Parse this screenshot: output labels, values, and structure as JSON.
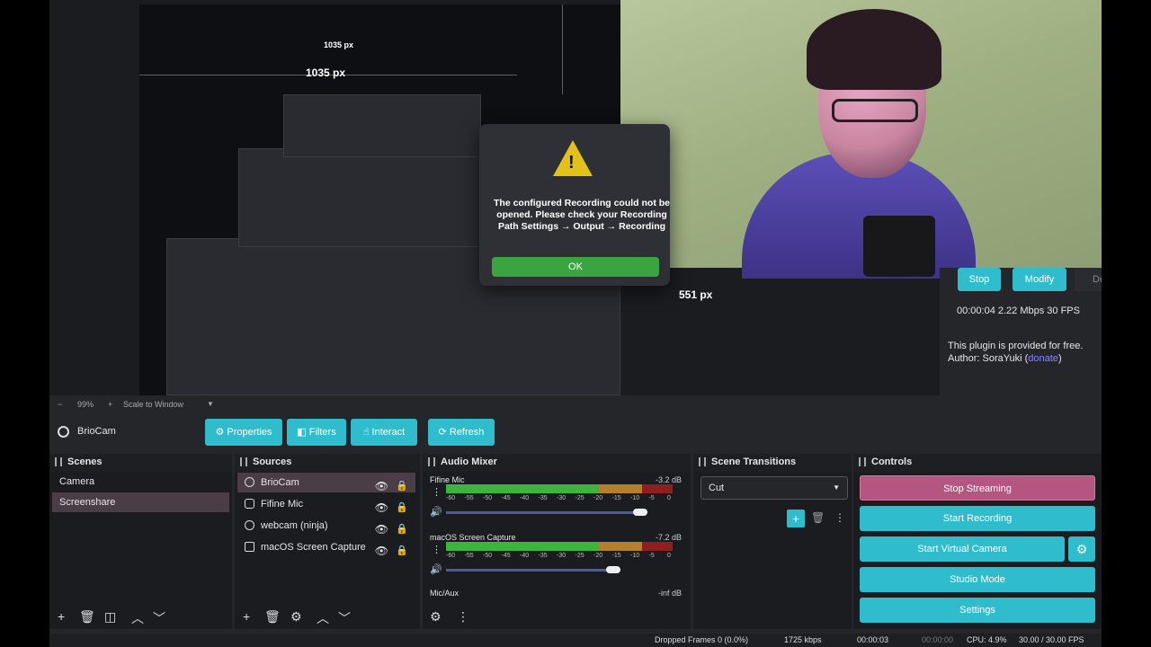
{
  "preview": {
    "measure_1": "1035 px",
    "measure_2": "1035 px",
    "measure_3": "551 px"
  },
  "dialog": {
    "message": "The configured Recording could not be opened. Please check your Recording Path Settings → Output → Recording",
    "ok_label": "OK"
  },
  "stream_panel": {
    "stop_label": "Stop",
    "modify_label": "Modify",
    "extra_label": "De",
    "stats": "00:00:04  2.22 Mbps  30 FPS",
    "plugin_line1": "This plugin is provided for free.",
    "plugin_line2_prefix": "Author: SoraYuki (",
    "plugin_link": "donate",
    "plugin_line2_suffix": ")"
  },
  "zoom_bar": {
    "minus": "−",
    "zoom": "99%",
    "plus": "+",
    "scale_mode": "Scale to Window"
  },
  "source_toolbar": {
    "source_name": "BrioCam",
    "properties": "Properties",
    "filters": "Filters",
    "interact": "Interact",
    "refresh": "Refresh"
  },
  "scenes": {
    "title": "Scenes",
    "items": [
      "Camera",
      "Screenshare"
    ]
  },
  "sources": {
    "title": "Sources",
    "items": [
      "BrioCam",
      "Fifine Mic",
      "webcam (ninja)",
      "macOS Screen Capture"
    ]
  },
  "audio_mixer": {
    "title": "Audio Mixer",
    "channels": [
      {
        "name": "Fifine Mic",
        "db": "-3.2 dB",
        "level": 0.78
      },
      {
        "name": "macOS Screen Capture",
        "db": "-7.2 dB",
        "level": 0.7
      },
      {
        "name": "Mic/Aux",
        "db": "-inf dB",
        "level": 0
      }
    ],
    "ticks": [
      "-60",
      "-55",
      "-50",
      "-45",
      "-40",
      "-35",
      "-30",
      "-25",
      "-20",
      "-15",
      "-10",
      "-5",
      "0"
    ]
  },
  "scene_transitions": {
    "title": "Scene Transitions",
    "selected": "Cut"
  },
  "controls": {
    "title": "Controls",
    "stop_streaming": "Stop Streaming",
    "start_recording": "Start Recording",
    "start_virtual_camera": "Start Virtual Camera",
    "studio_mode": "Studio Mode",
    "settings": "Settings"
  },
  "status_bar": {
    "dropped_frames": "Dropped Frames 0 (0.0%)",
    "bitrate": "1725 kbps",
    "stream_time": "00:00:03",
    "record_time": "00:00:00",
    "cpu": "CPU: 4.9%",
    "fps": "30.00 / 30.00 FPS"
  },
  "colors": {
    "accent": "#2fbccc",
    "stop": "#b55680",
    "ok": "#3aa540"
  }
}
